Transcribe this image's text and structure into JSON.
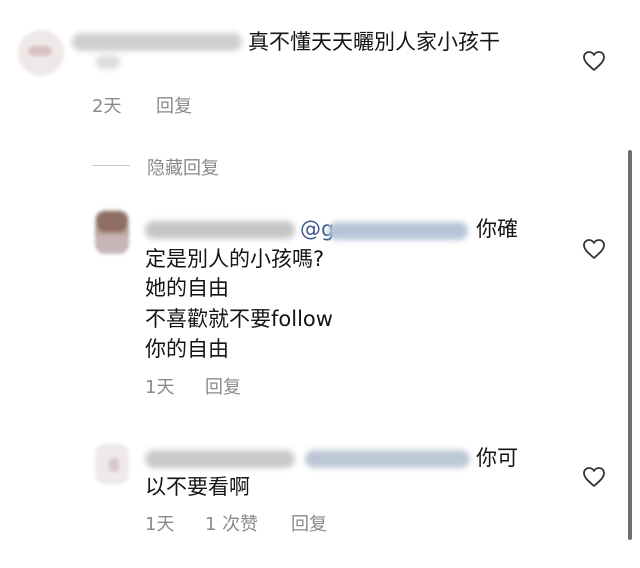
{
  "comments": [
    {
      "text_line_1": "真不懂天天曬別人家小孩干",
      "time": "2天",
      "reply_label": "回复"
    }
  ],
  "hidden_replies_label": "隐藏回复",
  "replies": [
    {
      "mention": "@g",
      "text_line_1_tail": "你確",
      "text_lines": [
        "定是別人的小孩嗎?",
        "她的自由",
        "不喜歡就不要follow",
        "你的自由"
      ],
      "time": "1天",
      "reply_label": "回复"
    },
    {
      "text_line_1_tail": "你可",
      "text_lines": [
        "以不要看啊"
      ],
      "time": "1天",
      "likes_label": "1 次赞",
      "reply_label": "回复"
    }
  ],
  "icons": {
    "like": "heart-outline-icon"
  },
  "colors": {
    "text": "#151515",
    "meta": "#8a8a8a",
    "mention": "#3a5a8c",
    "scrollbar": "#6f6f6f"
  }
}
